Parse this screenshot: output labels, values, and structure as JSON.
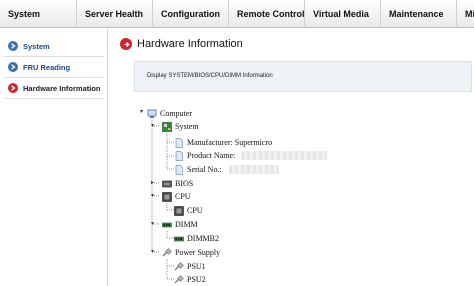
{
  "topnav": {
    "tabs": [
      {
        "label": "System"
      },
      {
        "label": "Server Health"
      },
      {
        "label": "Configuration"
      },
      {
        "label": "Remote Control"
      },
      {
        "label": "Virtual Media"
      },
      {
        "label": "Maintenance"
      },
      {
        "label": "Misc"
      }
    ]
  },
  "sidebar": {
    "items": [
      {
        "label": "System",
        "active": false
      },
      {
        "label": "FRU Reading",
        "active": false
      },
      {
        "label": "Hardware Information",
        "active": true
      }
    ]
  },
  "main": {
    "title": "Hardware Information",
    "description": "Display SYSTEM/BIOS/CPU/DIMM Information"
  },
  "tree": {
    "computer": "Computer",
    "system": "System",
    "manufacturer": "Manufacturer: Supermicro",
    "product_name": "Product Name:",
    "serial_no": "Serial No.:",
    "bios": "BIOS",
    "cpu_group": "CPU",
    "cpu": "CPU",
    "dimm_group": "DIMM",
    "dimm": "DIMMB2",
    "power_supply": "Power Supply",
    "psu1": "PSU1",
    "psu2": "PSU2"
  },
  "colors": {
    "accent_red": "#d0242a",
    "sidebar_text": "#1a4a8a",
    "sidebar_active_text": "#222222",
    "info_bg": "#eef2f7"
  }
}
